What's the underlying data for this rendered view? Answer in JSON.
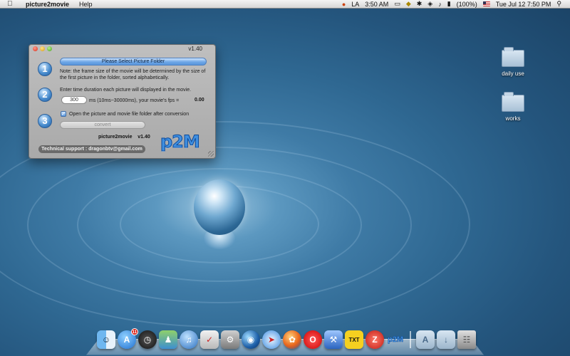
{
  "menubar": {
    "app_name": "picture2movie",
    "menus": [
      "Help"
    ],
    "status": {
      "input_locale": "LA",
      "time_zone_clock": "3:50 AM",
      "battery": "(100%)",
      "datetime": "Tue Jul 12  7:50 PM"
    }
  },
  "window": {
    "version": "v1.40",
    "steps": [
      "1",
      "2",
      "3"
    ],
    "select_button_label": "Please Select Picture Folder",
    "note_text": "Note: the frame size of the movie will be determined by the size of the first picture in the folder, sorted alphabetically.",
    "duration_prompt": "Enter time duration each picture will displayed in the movie.",
    "duration_value": "300",
    "duration_suffix": "ms (10ms~30000ms), your movie's fps =",
    "fps_value": "0.00",
    "open_folder_checked": true,
    "open_folder_label": "Open the picture and movie file folder after conversion",
    "convert_button_label": "convert",
    "brand_name": "picture2movie",
    "brand_version": "v1.40",
    "logo_text": "p2M",
    "support_text": "Technical support : dragonbtv@gmail.com"
  },
  "desktop": {
    "folders": [
      {
        "label": "daily use",
        "icon": "folder-icon"
      },
      {
        "label": "works",
        "icon": "folder-icon"
      }
    ]
  },
  "dock": {
    "app_store_badge": "11",
    "txt_label": "TXT",
    "p2m_label": "p2M"
  },
  "colors": {
    "accent_blue": "#5a96dc",
    "desktop_blue": "#2f6892",
    "support_bar": "#6a6a6a"
  }
}
